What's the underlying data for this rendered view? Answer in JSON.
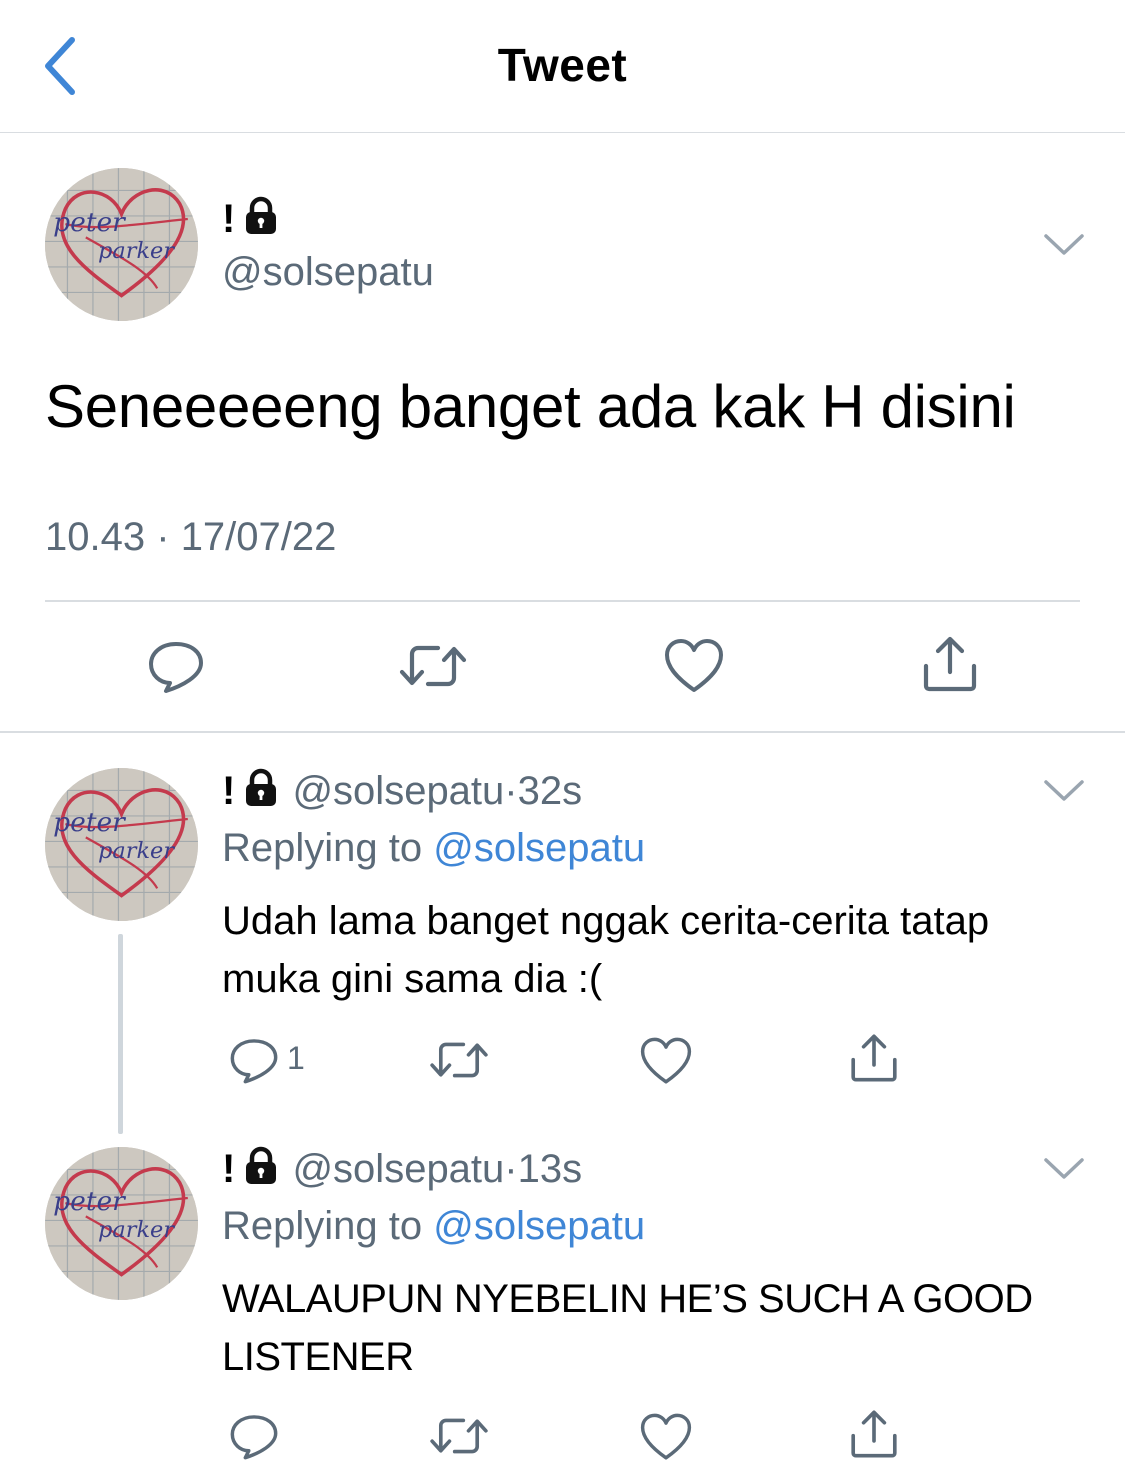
{
  "header": {
    "title": "Tweet"
  },
  "main_tweet": {
    "display_name": "!",
    "handle": "@solsepatu",
    "text": "Seneeeeeng banget ada kak H disini",
    "time": "10.43",
    "separator": "·",
    "date": "17/07/22"
  },
  "replies": [
    {
      "display_name": "!",
      "handle": "@solsepatu",
      "separator": "·",
      "time": "32s",
      "replying_label": "Replying to",
      "replying_to": "@solsepatu",
      "text": "Udah lama banget nggak cerita-cerita tatap muka gini sama dia :(",
      "reply_count": "1"
    },
    {
      "display_name": "!",
      "handle": "@solsepatu",
      "separator": "·",
      "time": "13s",
      "replying_label": "Replying to",
      "replying_to": "@solsepatu",
      "text": "WALAUPUN NYEBELIN HE’S SUCH A GOOD LISTENER",
      "reply_count": ""
    }
  ],
  "avatar": {
    "line1": "peter",
    "line2": "parker"
  },
  "colors": {
    "link": "#3f86d6",
    "muted": "#5b6a78",
    "divider": "#d9dde1",
    "back": "#3f86d6"
  },
  "icons": [
    "back-chevron-icon",
    "lock-icon",
    "chevron-down-icon",
    "reply-icon",
    "retweet-icon",
    "like-icon",
    "share-icon"
  ]
}
